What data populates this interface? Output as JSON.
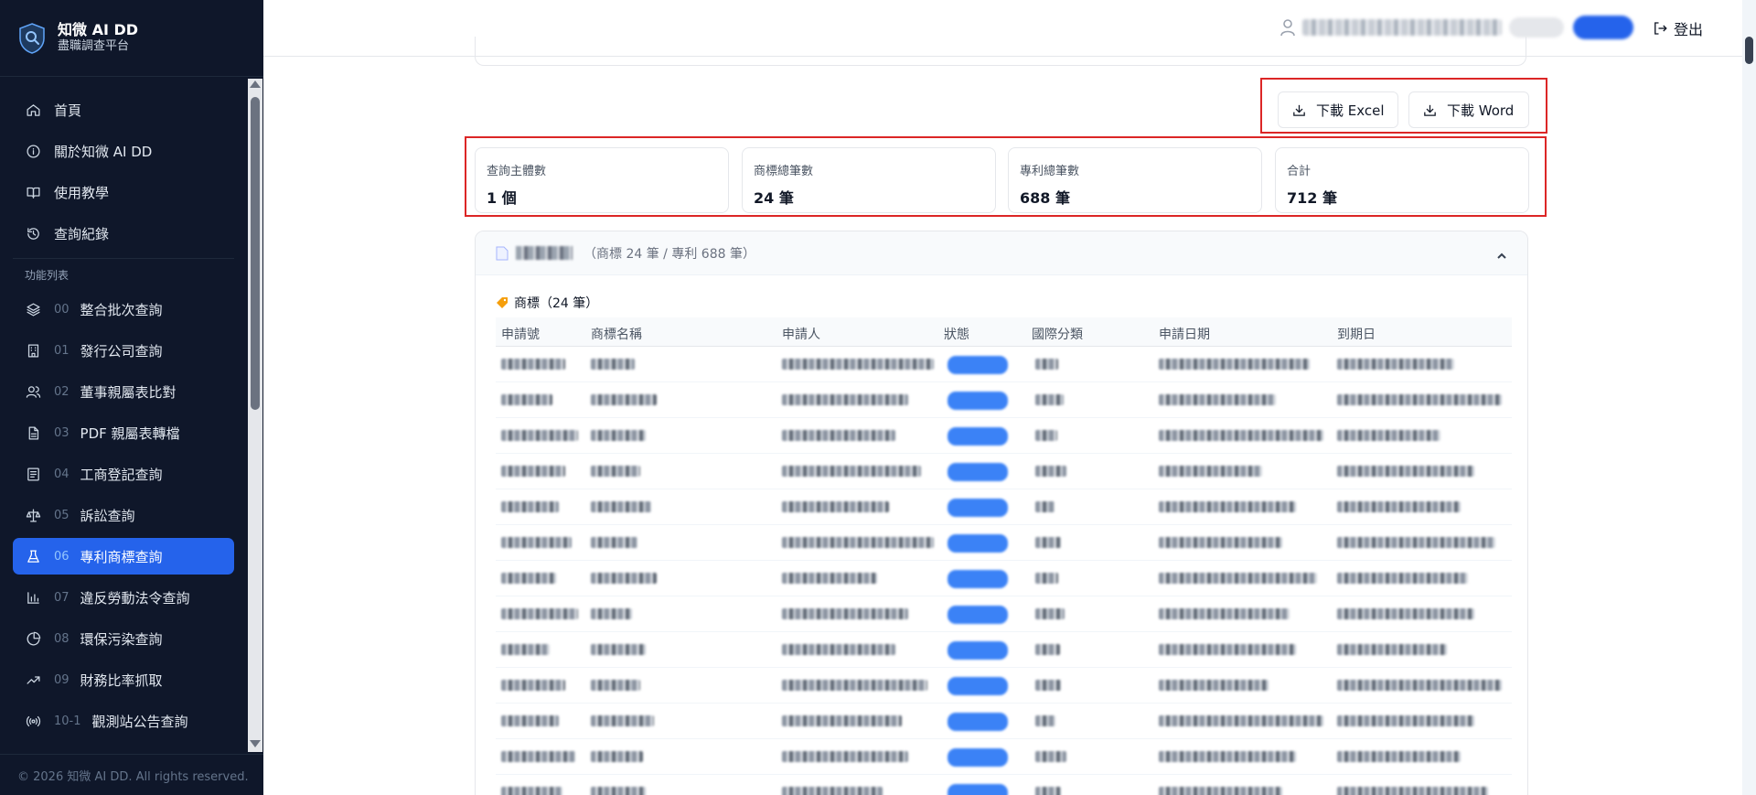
{
  "app": {
    "name": "知微 AI DD",
    "subtitle": "盡職調查平台"
  },
  "sidebar": {
    "items": [
      {
        "label": "首頁",
        "icon": "home-icon"
      },
      {
        "label": "關於知微 AI DD",
        "icon": "info-icon"
      },
      {
        "label": "使用教學",
        "icon": "book-icon"
      },
      {
        "label": "查詢紀錄",
        "icon": "history-icon"
      }
    ],
    "section_label": "功能列表",
    "features": [
      {
        "num": "00",
        "label": "整合批次查詢",
        "icon": "layers-icon"
      },
      {
        "num": "01",
        "label": "發行公司查詢",
        "icon": "building-icon"
      },
      {
        "num": "02",
        "label": "董事親屬表比對",
        "icon": "users-icon"
      },
      {
        "num": "03",
        "label": "PDF 親屬表轉檔",
        "icon": "file-icon"
      },
      {
        "num": "04",
        "label": "工商登記查詢",
        "icon": "registry-icon"
      },
      {
        "num": "05",
        "label": "訴訟查詢",
        "icon": "scale-icon"
      },
      {
        "num": "06",
        "label": "專利商標查詢",
        "icon": "flask-icon",
        "active": true
      },
      {
        "num": "07",
        "label": "違反勞動法令查詢",
        "icon": "bar-chart-icon"
      },
      {
        "num": "08",
        "label": "環保污染查詢",
        "icon": "pie-chart-icon"
      },
      {
        "num": "09",
        "label": "財務比率抓取",
        "icon": "trending-icon"
      },
      {
        "num": "10-1",
        "label": "觀測站公告查詢",
        "icon": "broadcast-icon"
      }
    ],
    "footer": "© 2026 知微 AI DD. All rights reserved."
  },
  "topbar": {
    "logout_label": "登出"
  },
  "actions": {
    "excel_label": "下載 Excel",
    "word_label": "下載 Word"
  },
  "stats": [
    {
      "label": "查詢主體數",
      "value": "1 個"
    },
    {
      "label": "商標總筆數",
      "value": "24 筆"
    },
    {
      "label": "專利總筆數",
      "value": "688 筆"
    },
    {
      "label": "合計",
      "value": "712 筆"
    }
  ],
  "result": {
    "summary": "（商標 24 筆 / 專利 688 筆）",
    "trademark_heading": "商標（24 筆）",
    "columns": [
      "申請號",
      "商標名稱",
      "申請人",
      "狀態",
      "國際分類",
      "申請日期",
      "到期日"
    ]
  },
  "colors": {
    "sidebar_bg": "#0f172a",
    "accent": "#2563eb",
    "highlight_border": "#dc2626"
  }
}
